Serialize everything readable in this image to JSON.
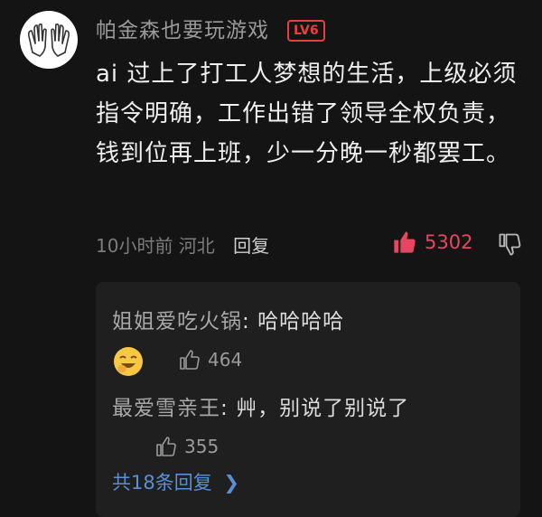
{
  "comment": {
    "username": "帕金森也要玩游戏",
    "level_badge": "LV6",
    "body": "ai 过上了打工人梦想的生活，上级必须指令明确，工作出错了领导全权负责，钱到位再上班，少一分晚一秒都罢工。",
    "time": "10小时前",
    "location": "河北",
    "reply_label": "回复",
    "likes": "5302",
    "icons": {
      "avatar": "praying-hands-avatar",
      "like": "thumbs-up-icon",
      "dislike": "thumbs-down-icon"
    },
    "colors": {
      "like_active": "#e6465f",
      "badge": "#e8403f",
      "link": "#5a8fd6"
    }
  },
  "replies": [
    {
      "author": "姐姐爱吃火锅",
      "sep": ": ",
      "text": "哈哈哈哈",
      "emoji": "laughing-emoji",
      "likes": "464"
    },
    {
      "author": "最爱雪亲王",
      "sep": ": ",
      "text": "艸，别说了别说了",
      "likes": "355"
    }
  ],
  "more_replies_label": "共18条回复"
}
